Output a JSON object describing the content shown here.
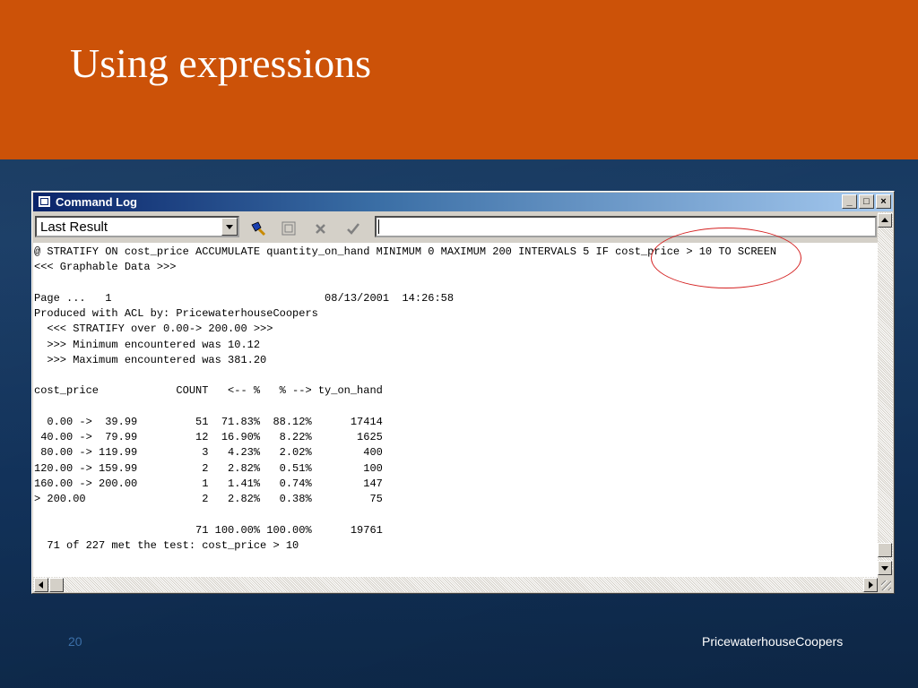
{
  "slide": {
    "title": "Using expressions",
    "number": "20",
    "brand": "PricewaterhouseCoopers"
  },
  "window": {
    "title": "Command Log",
    "buttons": {
      "minimize": "_",
      "maximize": "□",
      "close": "×"
    },
    "toolbar": {
      "combo_value": "Last Result",
      "command_value": "",
      "icons": [
        "flashlight-icon",
        "notepad-icon",
        "cancel-x-icon",
        "check-icon"
      ]
    },
    "log_lines": [
      "@ STRATIFY ON cost_price ACCUMULATE quantity_on_hand MINIMUM 0 MAXIMUM 200 INTERVALS 5 IF cost_price > 10 TO SCREEN",
      "<<< Graphable Data >>>",
      "",
      "Page ...   1                                 08/13/2001  14:26:58",
      "Produced with ACL by: PricewaterhouseCoopers",
      "  <<< STRATIFY over 0.00-> 200.00 >>>",
      "  >>> Minimum encountered was 10.12",
      "  >>> Maximum encountered was 381.20",
      "",
      "cost_price            COUNT   <-- %   % --> ty_on_hand",
      "",
      "  0.00 ->  39.99         51  71.83%  88.12%      17414",
      " 40.00 ->  79.99         12  16.90%   8.22%       1625",
      " 80.00 -> 119.99          3   4.23%   2.02%        400",
      "120.00 -> 159.99          2   2.82%   0.51%        100",
      "160.00 -> 200.00          1   1.41%   0.74%        147",
      "> 200.00                  2   2.82%   0.38%         75",
      "",
      "                         71 100.00% 100.00%      19761",
      "  71 of 227 met the test: cost_price > 10"
    ]
  }
}
